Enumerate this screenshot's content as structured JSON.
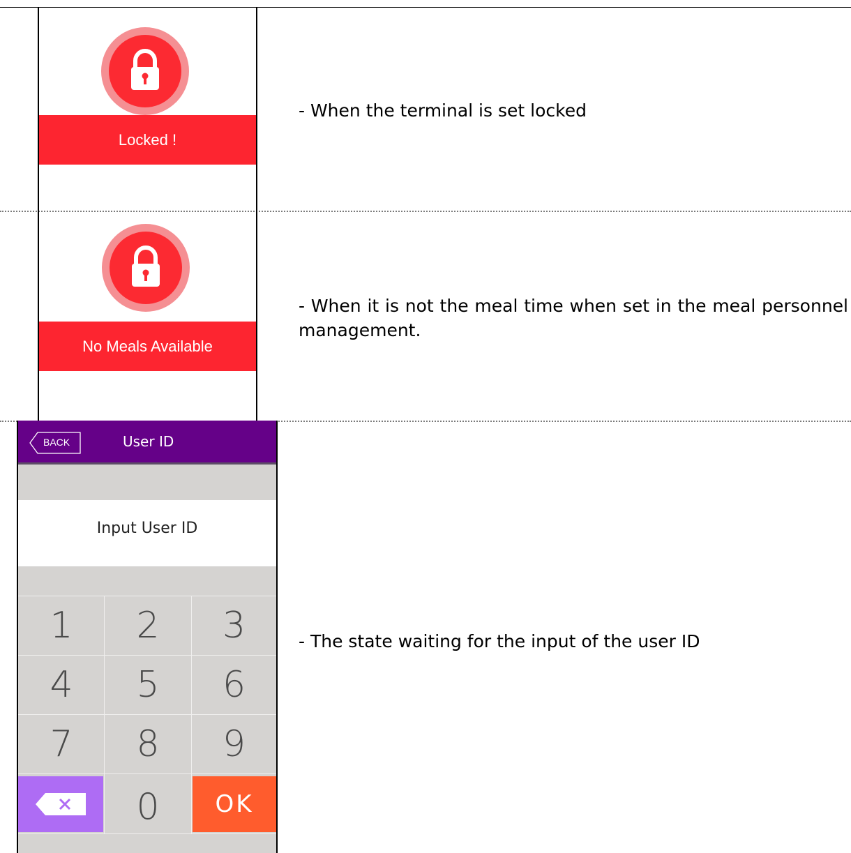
{
  "rows": [
    {
      "badge_label": "Locked !",
      "description": "- When the terminal is set locked"
    },
    {
      "badge_label": "No Meals Available",
      "description": "- When it is not the meal time when set in the meal personnel management."
    },
    {
      "description": "- The state waiting for the input of the user ID"
    }
  ],
  "device": {
    "back_label": "BACK",
    "title": "User ID",
    "prompt": "Input User ID",
    "keys": [
      "1",
      "2",
      "3",
      "4",
      "5",
      "6",
      "7",
      "8",
      "9"
    ],
    "zero": "0",
    "ok_label": "OK",
    "colors": {
      "header": "#650188",
      "delete_key": "#ae6cf4",
      "ok_key": "#ff5c2d",
      "lock_red": "#fd2530"
    }
  }
}
